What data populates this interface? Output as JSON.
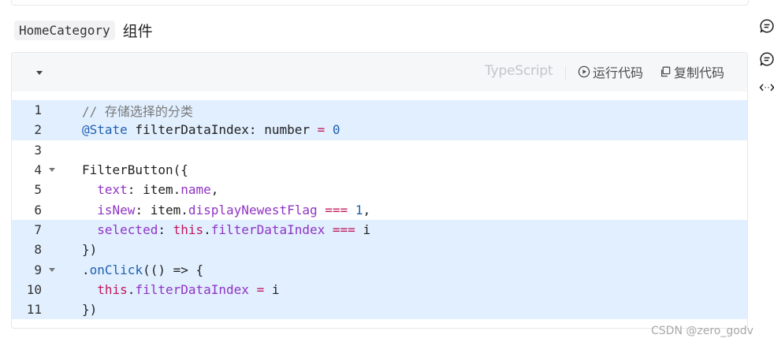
{
  "heading": {
    "component_name": "HomeCategory",
    "suffix": "组件"
  },
  "code_block": {
    "language": "TypeScript",
    "run_label": "运行代码",
    "copy_label": "复制代码",
    "highlight_color": "#e1efff",
    "lines": [
      {
        "number": "1",
        "highlighted": true,
        "foldable": false,
        "tokens": [
          {
            "text": "// 存储选择的分类",
            "cls": "c-comment"
          }
        ]
      },
      {
        "number": "2",
        "highlighted": true,
        "foldable": false,
        "tokens": [
          {
            "text": "@State",
            "cls": "c-blue"
          },
          {
            "text": " filterDataIndex: number ",
            "cls": ""
          },
          {
            "text": "=",
            "cls": "c-red"
          },
          {
            "text": " ",
            "cls": ""
          },
          {
            "text": "0",
            "cls": "c-blue"
          }
        ]
      },
      {
        "number": "3",
        "highlighted": false,
        "foldable": false,
        "tokens": []
      },
      {
        "number": "4",
        "highlighted": false,
        "foldable": true,
        "tokens": [
          {
            "text": "FilterButton({",
            "cls": ""
          }
        ]
      },
      {
        "number": "5",
        "highlighted": false,
        "foldable": false,
        "tokens": [
          {
            "text": "  ",
            "cls": ""
          },
          {
            "text": "text",
            "cls": "c-purple"
          },
          {
            "text": ": item.",
            "cls": ""
          },
          {
            "text": "name",
            "cls": "c-purple"
          },
          {
            "text": ",",
            "cls": ""
          }
        ]
      },
      {
        "number": "6",
        "highlighted": false,
        "foldable": false,
        "tokens": [
          {
            "text": "  ",
            "cls": ""
          },
          {
            "text": "isNew",
            "cls": "c-purple"
          },
          {
            "text": ": item.",
            "cls": ""
          },
          {
            "text": "displayNewestFlag",
            "cls": "c-purple"
          },
          {
            "text": " ",
            "cls": ""
          },
          {
            "text": "===",
            "cls": "c-red"
          },
          {
            "text": " ",
            "cls": ""
          },
          {
            "text": "1",
            "cls": "c-blue"
          },
          {
            "text": ",",
            "cls": ""
          }
        ]
      },
      {
        "number": "7",
        "highlighted": true,
        "foldable": false,
        "tokens": [
          {
            "text": "  ",
            "cls": ""
          },
          {
            "text": "selected",
            "cls": "c-purple"
          },
          {
            "text": ": ",
            "cls": ""
          },
          {
            "text": "this",
            "cls": "c-kw"
          },
          {
            "text": ".",
            "cls": ""
          },
          {
            "text": "filterDataIndex",
            "cls": "c-purple"
          },
          {
            "text": " ",
            "cls": ""
          },
          {
            "text": "===",
            "cls": "c-red"
          },
          {
            "text": " i",
            "cls": ""
          }
        ]
      },
      {
        "number": "8",
        "highlighted": true,
        "foldable": false,
        "tokens": [
          {
            "text": "})",
            "cls": ""
          }
        ]
      },
      {
        "number": "9",
        "highlighted": true,
        "foldable": true,
        "tokens": [
          {
            "text": ".",
            "cls": ""
          },
          {
            "text": "onClick",
            "cls": "c-blue"
          },
          {
            "text": "(() => {",
            "cls": ""
          }
        ]
      },
      {
        "number": "10",
        "highlighted": true,
        "foldable": false,
        "tokens": [
          {
            "text": "  ",
            "cls": ""
          },
          {
            "text": "this",
            "cls": "c-kw"
          },
          {
            "text": ".",
            "cls": ""
          },
          {
            "text": "filterDataIndex",
            "cls": "c-purple"
          },
          {
            "text": " ",
            "cls": ""
          },
          {
            "text": "=",
            "cls": "c-red"
          },
          {
            "text": " i",
            "cls": ""
          }
        ]
      },
      {
        "number": "11",
        "highlighted": true,
        "foldable": false,
        "tokens": [
          {
            "text": "})",
            "cls": ""
          }
        ]
      }
    ]
  },
  "side_icons": [
    "comment-icon",
    "comment-icon",
    "expand-horizontal-icon"
  ],
  "watermark": "CSDN @zero_godv"
}
